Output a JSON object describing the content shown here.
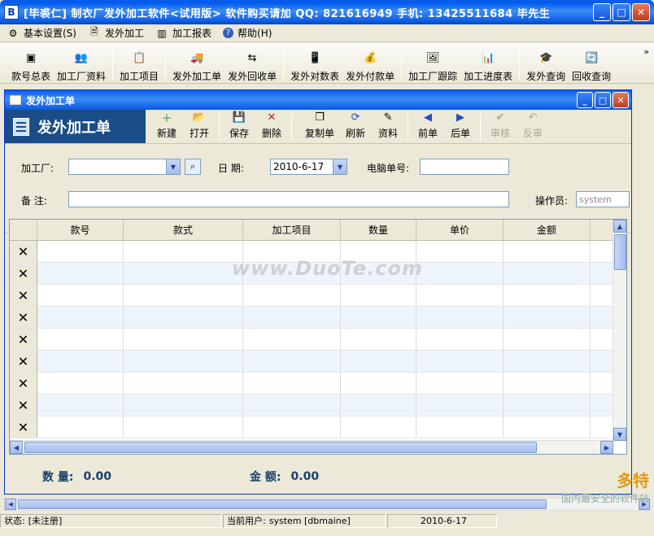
{
  "window": {
    "title": "[毕裘仁] 制衣厂发外加工软件<试用版>  软件购买请加 QQ: 821616949 手机: 13425511684 毕先生",
    "icon_text": "B"
  },
  "menu": [
    {
      "label": "基本设置(S)",
      "icon": "settings-icon"
    },
    {
      "label": "发外加工",
      "icon": "document-icon"
    },
    {
      "label": "加工报表",
      "icon": "chart-icon"
    },
    {
      "label": "帮助(H)",
      "icon": "help-icon"
    }
  ],
  "toolbar": [
    {
      "label": "款号总表",
      "glyph": "▣"
    },
    {
      "label": "加工厂资料",
      "glyph": "👥"
    },
    {
      "label": "加工项目",
      "glyph": "📋"
    },
    {
      "label": "发外加工单",
      "glyph": "🚚"
    },
    {
      "label": "发外回收单",
      "glyph": "⇆"
    },
    {
      "label": "发外对数表",
      "glyph": "📱"
    },
    {
      "label": "发外付款单",
      "glyph": "💰"
    },
    {
      "label": "加工厂跟踪",
      "glyph": "🖼"
    },
    {
      "label": "加工进度表",
      "glyph": "📊"
    },
    {
      "label": "发外查询",
      "glyph": "🎓"
    },
    {
      "label": "回收查询",
      "glyph": "🔄"
    }
  ],
  "child_window": {
    "title": "发外加工单",
    "banner": "发外加工单",
    "buttons": [
      {
        "label": "新建",
        "glyph": "＋",
        "enabled": true
      },
      {
        "label": "打开",
        "glyph": "📂",
        "enabled": true
      },
      {
        "label": "保存",
        "glyph": "💾",
        "enabled": true
      },
      {
        "label": "删除",
        "glyph": "✕",
        "enabled": true
      },
      {
        "label": "复制单",
        "glyph": "❐",
        "enabled": true
      },
      {
        "label": "刷新",
        "glyph": "⟳",
        "enabled": true
      },
      {
        "label": "资料",
        "glyph": "✎",
        "enabled": true
      },
      {
        "label": "前单",
        "glyph": "◀",
        "enabled": true
      },
      {
        "label": "后单",
        "glyph": "▶",
        "enabled": true
      },
      {
        "label": "审核",
        "glyph": "✔",
        "enabled": false
      },
      {
        "label": "反审",
        "glyph": "↶",
        "enabled": false
      }
    ]
  },
  "form": {
    "factory_label": "加工厂:",
    "factory_value": "",
    "date_label": "日  期:",
    "date_value": "2010-6-17",
    "pc_no_label": "电脑单号:",
    "pc_no_value": "",
    "remark_label": "备  注:",
    "remark_value": "",
    "operator_label": "操作员:",
    "operator_value": "system"
  },
  "grid": {
    "columns": [
      "款号",
      "款式",
      "加工项目",
      "数量",
      "单价",
      "金额"
    ],
    "row_count": 9,
    "rows": []
  },
  "totals": {
    "qty_label": "数  量:",
    "qty_value": "0.00",
    "amount_label": "金  额:",
    "amount_value": "0.00"
  },
  "watermark": "www.DuoTe.com",
  "status": {
    "state_label": "状态:",
    "state_value": "[未注册]",
    "user_label": "当前用户:",
    "user_value": "system [dbmaine]",
    "date": "2010-6-17"
  },
  "logo_watermark": {
    "text": "多特",
    "sub": "国内最安全的软件站"
  }
}
